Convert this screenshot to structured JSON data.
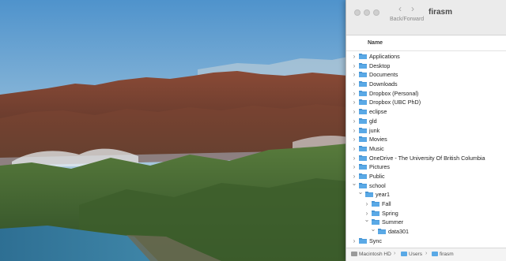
{
  "window": {
    "title": "firasm",
    "nav_caption": "Back/Forward",
    "back_glyph": "‹",
    "forward_glyph": "›"
  },
  "list": {
    "column_header": "Name",
    "items": [
      {
        "label": "Applications",
        "depth": 0,
        "expanded": false
      },
      {
        "label": "Desktop",
        "depth": 0,
        "expanded": false
      },
      {
        "label": "Documents",
        "depth": 0,
        "expanded": false
      },
      {
        "label": "Downloads",
        "depth": 0,
        "expanded": false
      },
      {
        "label": "Dropbox (Personal)",
        "depth": 0,
        "expanded": false
      },
      {
        "label": "Dropbox (UBC PhD)",
        "depth": 0,
        "expanded": false
      },
      {
        "label": "eclipse",
        "depth": 0,
        "expanded": false
      },
      {
        "label": "gld",
        "depth": 0,
        "expanded": false
      },
      {
        "label": "junk",
        "depth": 0,
        "expanded": false
      },
      {
        "label": "Movies",
        "depth": 0,
        "expanded": false
      },
      {
        "label": "Music",
        "depth": 0,
        "expanded": false
      },
      {
        "label": "OneDrive - The University Of British Columbia",
        "depth": 0,
        "expanded": false
      },
      {
        "label": "Pictures",
        "depth": 0,
        "expanded": false
      },
      {
        "label": "Public",
        "depth": 0,
        "expanded": false
      },
      {
        "label": "school",
        "depth": 0,
        "expanded": true
      },
      {
        "label": "year1",
        "depth": 1,
        "expanded": true
      },
      {
        "label": "Fall",
        "depth": 2,
        "expanded": false
      },
      {
        "label": "Spring",
        "depth": 2,
        "expanded": false
      },
      {
        "label": "Summer",
        "depth": 2,
        "expanded": true
      },
      {
        "label": "data301",
        "depth": 3,
        "expanded": true
      },
      {
        "label": "Sync",
        "depth": 0,
        "expanded": false
      }
    ]
  },
  "pathbar": {
    "crumbs": [
      "Macintosh HD",
      "Users",
      "firasm"
    ],
    "separator": "›"
  },
  "colors": {
    "folder_blue": "#5aa9e6",
    "folder_blue_dark": "#3f8fd0",
    "sky_top": "#5c9bd0",
    "sky_bottom": "#c9dbe6"
  },
  "icons": {
    "traffic_lights": [
      "close-icon",
      "minimize-icon",
      "zoom-icon"
    ],
    "folder": "folder-icon",
    "disclosure": "chevron-icon",
    "disk": "hard-drive-icon"
  }
}
